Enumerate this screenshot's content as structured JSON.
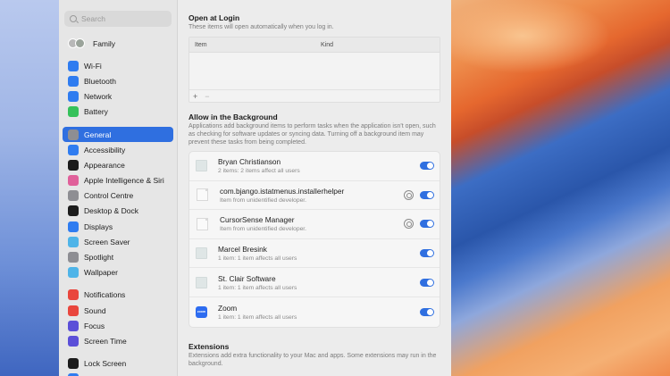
{
  "sidebar": {
    "search_placeholder": "Search",
    "family": "Family",
    "groups": [
      [
        {
          "label": "Wi-Fi",
          "icon": "wifi-icon",
          "color": "#2f7cf0"
        },
        {
          "label": "Bluetooth",
          "icon": "bluetooth-icon",
          "color": "#2f7cf0"
        },
        {
          "label": "Network",
          "icon": "globe-icon",
          "color": "#2f7cf0"
        },
        {
          "label": "Battery",
          "icon": "battery-icon",
          "color": "#35c15a"
        }
      ],
      [
        {
          "label": "General",
          "icon": "gear-icon",
          "color": "#8e8e93",
          "active": true
        },
        {
          "label": "Accessibility",
          "icon": "accessibility-icon",
          "color": "#2f7cf0"
        },
        {
          "label": "Appearance",
          "icon": "appearance-icon",
          "color": "#1c1c1c"
        },
        {
          "label": "Apple Intelligence & Siri",
          "icon": "siri-icon",
          "color": "#e0609a"
        },
        {
          "label": "Control Centre",
          "icon": "control-centre-icon",
          "color": "#8e8e93"
        },
        {
          "label": "Desktop & Dock",
          "icon": "dock-icon",
          "color": "#1c1c1c"
        },
        {
          "label": "Displays",
          "icon": "display-icon",
          "color": "#2f7cf0"
        },
        {
          "label": "Screen Saver",
          "icon": "screensaver-icon",
          "color": "#4fb4e8"
        },
        {
          "label": "Spotlight",
          "icon": "spotlight-icon",
          "color": "#8e8e93"
        },
        {
          "label": "Wallpaper",
          "icon": "wallpaper-icon",
          "color": "#4fb4e8"
        }
      ],
      [
        {
          "label": "Notifications",
          "icon": "bell-icon",
          "color": "#e9463d"
        },
        {
          "label": "Sound",
          "icon": "sound-icon",
          "color": "#e9463d"
        },
        {
          "label": "Focus",
          "icon": "moon-icon",
          "color": "#5b4fd8"
        },
        {
          "label": "Screen Time",
          "icon": "hourglass-icon",
          "color": "#5b4fd8"
        }
      ],
      [
        {
          "label": "Lock Screen",
          "icon": "lock-icon",
          "color": "#1c1c1c"
        },
        {
          "label": "Privacy & Security",
          "icon": "hand-icon",
          "color": "#2f7cf0"
        }
      ]
    ]
  },
  "login": {
    "title": "Open at Login",
    "desc": "These items will open automatically when you log in.",
    "col_item": "Item",
    "col_kind": "Kind",
    "add": "+",
    "remove": "−"
  },
  "background": {
    "title": "Allow in the Background",
    "desc": "Applications add background items to perform tasks when the application isn't open, such as checking for software updates or syncing data. Turning off a background item may prevent these tasks from being completed.",
    "items": [
      {
        "name": "Bryan Christianson",
        "sub": "2 items: 2 items affect all users",
        "icon": "generic",
        "info": false,
        "on": true
      },
      {
        "name": "com.bjango.istatmenus.installerhelper",
        "sub": "Item from unidentified developer.",
        "icon": "doc",
        "info": true,
        "on": true
      },
      {
        "name": "CursorSense Manager",
        "sub": "Item from unidentified developer.",
        "icon": "doc",
        "info": true,
        "on": true
      },
      {
        "name": "Marcel Bresink",
        "sub": "1 item: 1 item affects all users",
        "icon": "generic",
        "info": false,
        "on": true
      },
      {
        "name": "St. Clair Software",
        "sub": "1 item: 1 item affects all users",
        "icon": "generic",
        "info": false,
        "on": true
      },
      {
        "name": "Zoom",
        "sub": "1 item: 1 item affects all users",
        "icon": "zoom",
        "info": false,
        "on": true
      }
    ]
  },
  "extensions": {
    "title": "Extensions",
    "desc": "Extensions add extra functionality to your Mac and apps. Some extensions may run in the background."
  }
}
